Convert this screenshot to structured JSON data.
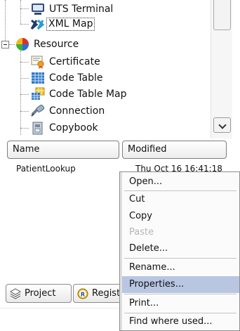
{
  "tree": {
    "items": [
      {
        "label": "UTS Terminal",
        "icon": "terminal-icon"
      },
      {
        "label": "XML Map",
        "icon": "xml-map-icon"
      },
      {
        "label": "Resource",
        "icon": "resource-icon"
      },
      {
        "label": "Certificate",
        "icon": "certificate-icon"
      },
      {
        "label": "Code Table",
        "icon": "code-table-icon"
      },
      {
        "label": "Code Table Map",
        "icon": "code-table-map-icon"
      },
      {
        "label": "Connection",
        "icon": "connection-icon"
      },
      {
        "label": "Copybook",
        "icon": "copybook-icon"
      }
    ]
  },
  "table": {
    "columns": [
      "Name",
      "Modified"
    ],
    "rows": [
      {
        "name": "PatientLookup",
        "modified": "Thu Oct 16 16:41:18"
      }
    ]
  },
  "tabs": [
    {
      "label": "Project",
      "icon": "project-icon"
    },
    {
      "label": "Registry",
      "icon": "registry-icon"
    }
  ],
  "context_menu": {
    "items": [
      {
        "label": "Open...",
        "enabled": true
      },
      {
        "label": "Cut",
        "enabled": true
      },
      {
        "label": "Copy",
        "enabled": true
      },
      {
        "label": "Paste",
        "enabled": false
      },
      {
        "label": "Delete...",
        "enabled": true
      },
      {
        "label": "Rename...",
        "enabled": true
      },
      {
        "label": "Properties...",
        "enabled": true,
        "selected": true
      },
      {
        "label": "Print...",
        "enabled": true
      },
      {
        "label": "Find where used...",
        "enabled": true
      }
    ]
  },
  "colors": {
    "menu_highlight": "#b8c6e2",
    "disabled_text": "#b5b5b5",
    "border": "#8e8e8e"
  }
}
